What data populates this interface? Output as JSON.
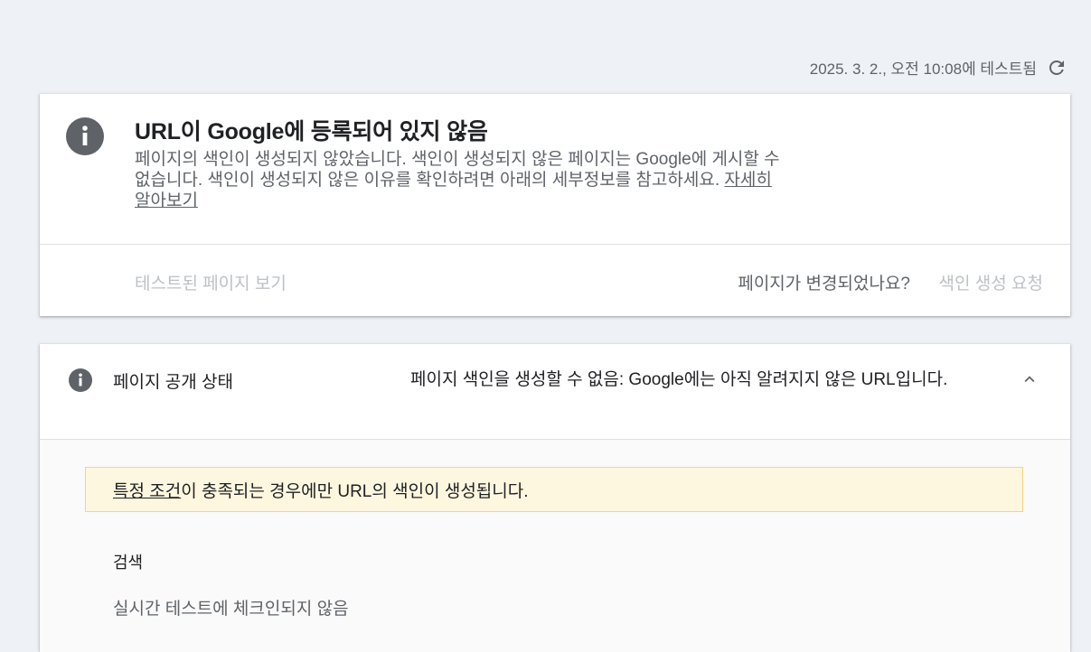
{
  "tested": {
    "timestamp": "2025. 3. 2., 오전 10:08에 테스트됨",
    "refresh_icon": "refresh-icon"
  },
  "status_card": {
    "icon": "info-icon",
    "title": "URL이 Google에 등록되어 있지 않음",
    "description": "페이지의 색인이 생성되지 않았습니다. 색인이 생성되지 않은 페이지는 Google에 게시할 수 없습니다. 색인이 생성되지 않은 이유를 확인하려면 아래의 세부정보를 참고하세요.",
    "learn_more": "자세히 알아보기",
    "view_tested_page": "테스트된 페이지 보기",
    "page_changed": "페이지가 변경되었나요?",
    "request_indexing": "색인 생성 요청"
  },
  "availability_card": {
    "icon": "info-icon",
    "label": "페이지 공개 상태",
    "value": "페이지 색인을 생성할 수 없음: Google에는 아직 알려지지 않은 URL입니다.",
    "collapse_icon": "chevron-up-icon",
    "notice_link": "특정 조건",
    "notice_rest": "이 충족되는 경우에만 URL의 색인이 생성됩니다.",
    "search_label": "검색",
    "search_value": "실시간 테스트에 체크인되지 않음"
  },
  "colors": {
    "background": "#eef1f6",
    "card": "#ffffff",
    "icon_gray": "#5f6368",
    "disabled_text": "#bdc1c6",
    "notice_bg": "#fef7e0",
    "notice_border": "#f9d57a"
  }
}
